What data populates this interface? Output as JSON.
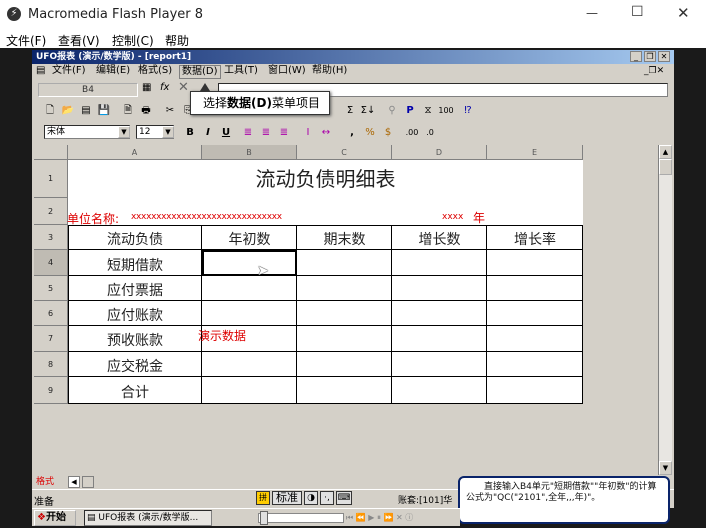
{
  "flash_window": {
    "title": "Macromedia Flash Player 8",
    "minimize": "—",
    "maximize": "☐",
    "close": "✕"
  },
  "flash_menu": [
    "文件(F)",
    "查看(V)",
    "控制(C)",
    "帮助"
  ],
  "app": {
    "title": "UFO报表 (演示/数学版) - [report1]"
  },
  "app_menu": [
    "文件(F)",
    "编辑(E)",
    "格式(S)",
    "数据(D)",
    "工具(T)",
    "窗口(W)",
    "帮助(H)"
  ],
  "cell_ref": "B4",
  "tooltip": {
    "prefix": "选择",
    "bold": "数据(D)",
    "suffix": "菜单项目"
  },
  "font_select": "宋体",
  "size_select": "12",
  "column_headers": [
    "A",
    "B",
    "C",
    "D",
    "E"
  ],
  "row_headers": [
    "1",
    "2",
    "3",
    "4",
    "5",
    "6",
    "7",
    "8",
    "9"
  ],
  "sheet": {
    "title": "流动负债明细表",
    "unit_label": "单位名称:",
    "unit_x": "xxxxxxxxxxxxxxxxxxxxxxxxxxxxxx",
    "year_x": "xxxx",
    "year_label": "年",
    "headers": [
      "流动负债",
      "年初数",
      "期末数",
      "增长数",
      "增长率"
    ],
    "rows": [
      "短期借款",
      "应付票据",
      "应付账款",
      "预收账款",
      "应交税金",
      "合计"
    ],
    "demo_text": "演示数据"
  },
  "sheet_tab": "格式",
  "status": {
    "ready": "准备",
    "ime": "标准",
    "account": "账套:[101]华"
  },
  "hint_box": "直接输入B4单元\"短期借款\"\"年初数\"的计算公式为\"QC(\"2101\",全年,,,年)\"。",
  "taskbar": {
    "start": "开始",
    "task": "UFO报表 (演示/数学版..."
  }
}
